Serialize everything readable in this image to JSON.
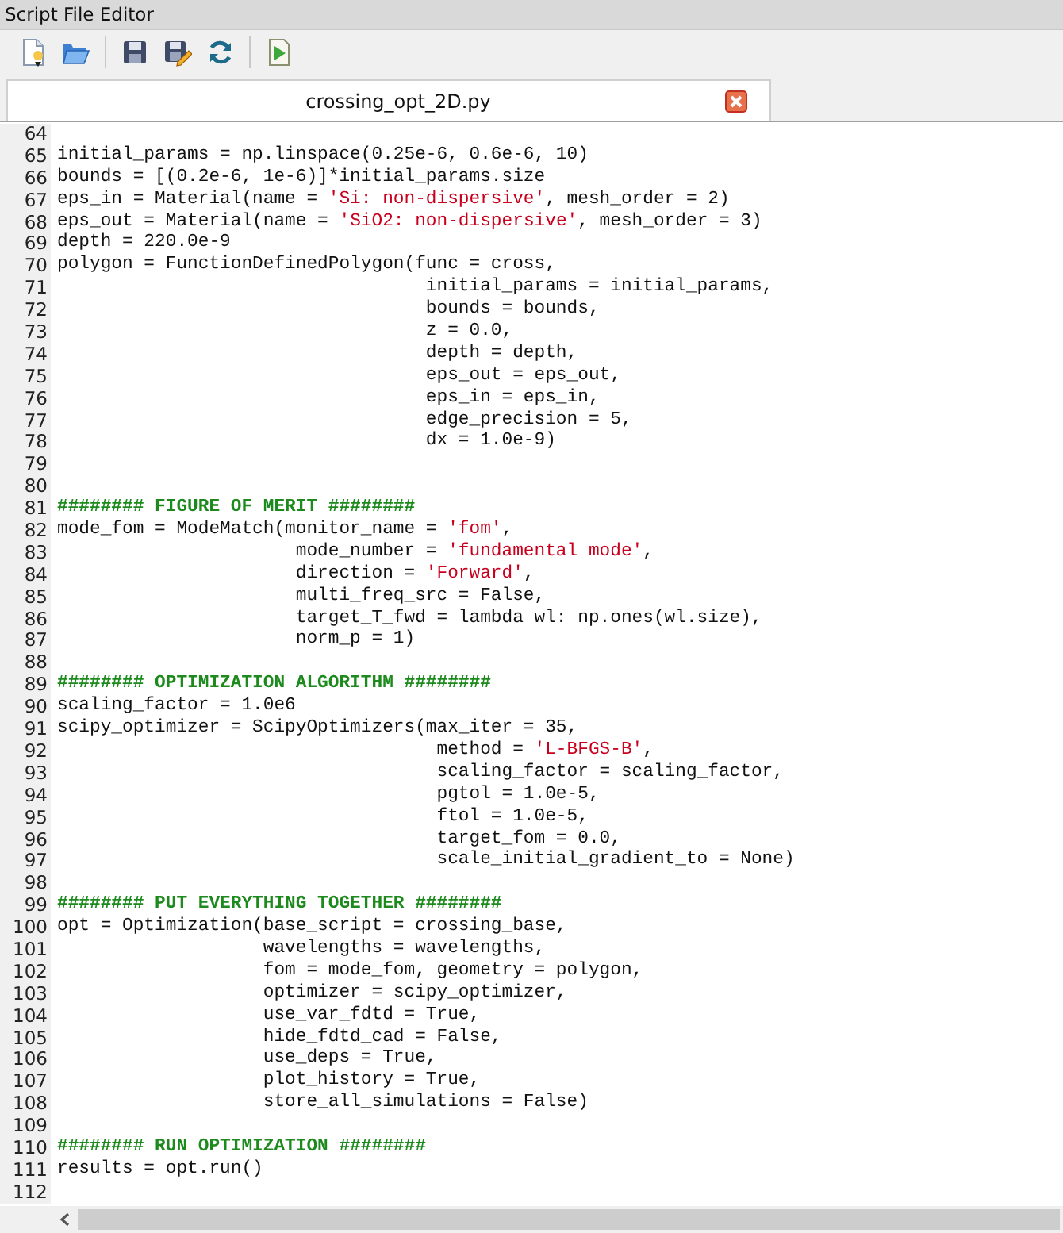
{
  "window": {
    "title": "Script File Editor"
  },
  "toolbar": [
    {
      "kind": "new"
    },
    {
      "kind": "open"
    },
    {
      "kind": "separator"
    },
    {
      "kind": "save"
    },
    {
      "kind": "save_as"
    },
    {
      "kind": "refresh"
    },
    {
      "kind": "separator"
    },
    {
      "kind": "run"
    }
  ],
  "tabs": [
    {
      "label": "crossing_opt_2D.py",
      "selected": true,
      "closable": true
    }
  ],
  "editor": {
    "lines": [
      {
        "number": "64"
      },
      {
        "number": "65",
        "segments": [
          {
            "kind": "code",
            "text": "initial_params = np.linspace(0.25e-6, 0.6e-6, 10)"
          }
        ]
      },
      {
        "number": "66",
        "segments": [
          {
            "kind": "code",
            "text": "bounds = [(0.2e-6, 1e-6)]*initial_params.size"
          }
        ]
      },
      {
        "number": "67",
        "segments": [
          {
            "kind": "code",
            "text": "eps_in = Material(name = "
          },
          {
            "kind": "string",
            "text": "'Si: non-dispersive'"
          },
          {
            "kind": "code",
            "text": ", mesh_order = 2)"
          }
        ]
      },
      {
        "number": "68",
        "segments": [
          {
            "kind": "code",
            "text": "eps_out = Material(name = "
          },
          {
            "kind": "string",
            "text": "'SiO2: non-dispersive'"
          },
          {
            "kind": "code",
            "text": ", mesh_order = 3)"
          }
        ]
      },
      {
        "number": "69",
        "segments": [
          {
            "kind": "code",
            "text": "depth = 220.0e-9"
          }
        ]
      },
      {
        "number": "70",
        "segments": [
          {
            "kind": "code",
            "text": "polygon = FunctionDefinedPolygon(func = cross,"
          }
        ]
      },
      {
        "number": "71",
        "segments": [
          {
            "kind": "code",
            "text": "                                  initial_params = initial_params,"
          }
        ]
      },
      {
        "number": "72",
        "segments": [
          {
            "kind": "code",
            "text": "                                  bounds = bounds,"
          }
        ]
      },
      {
        "number": "73",
        "segments": [
          {
            "kind": "code",
            "text": "                                  z = 0.0,"
          }
        ]
      },
      {
        "number": "74",
        "segments": [
          {
            "kind": "code",
            "text": "                                  depth = depth,"
          }
        ]
      },
      {
        "number": "75",
        "segments": [
          {
            "kind": "code",
            "text": "                                  eps_out = eps_out,"
          }
        ]
      },
      {
        "number": "76",
        "segments": [
          {
            "kind": "code",
            "text": "                                  eps_in = eps_in,"
          }
        ]
      },
      {
        "number": "77",
        "segments": [
          {
            "kind": "code",
            "text": "                                  edge_precision = 5,"
          }
        ]
      },
      {
        "number": "78",
        "segments": [
          {
            "kind": "code",
            "text": "                                  dx = 1.0e-9)"
          }
        ]
      },
      {
        "number": "79"
      },
      {
        "number": "80"
      },
      {
        "number": "81",
        "segments": [
          {
            "kind": "comment",
            "text": "######## FIGURE OF MERIT ########"
          }
        ]
      },
      {
        "number": "82",
        "segments": [
          {
            "kind": "code",
            "text": "mode_fom = ModeMatch(monitor_name = "
          },
          {
            "kind": "string",
            "text": "'fom'"
          },
          {
            "kind": "code",
            "text": ","
          }
        ]
      },
      {
        "number": "83",
        "segments": [
          {
            "kind": "code",
            "text": "                      mode_number = "
          },
          {
            "kind": "string",
            "text": "'fundamental mode'"
          },
          {
            "kind": "code",
            "text": ","
          }
        ]
      },
      {
        "number": "84",
        "segments": [
          {
            "kind": "code",
            "text": "                      direction = "
          },
          {
            "kind": "string",
            "text": "'Forward'"
          },
          {
            "kind": "code",
            "text": ","
          }
        ]
      },
      {
        "number": "85",
        "segments": [
          {
            "kind": "code",
            "text": "                      multi_freq_src = False,"
          }
        ]
      },
      {
        "number": "86",
        "segments": [
          {
            "kind": "code",
            "text": "                      target_T_fwd = lambda wl: np.ones(wl.size),"
          }
        ]
      },
      {
        "number": "87",
        "segments": [
          {
            "kind": "code",
            "text": "                      norm_p = 1)"
          }
        ]
      },
      {
        "number": "88"
      },
      {
        "number": "89",
        "segments": [
          {
            "kind": "comment",
            "text": "######## OPTIMIZATION ALGORITHM ########"
          }
        ]
      },
      {
        "number": "90",
        "segments": [
          {
            "kind": "code",
            "text": "scaling_factor = 1.0e6"
          }
        ]
      },
      {
        "number": "91",
        "segments": [
          {
            "kind": "code",
            "text": "scipy_optimizer = ScipyOptimizers(max_iter = 35,"
          }
        ]
      },
      {
        "number": "92",
        "segments": [
          {
            "kind": "code",
            "text": "                                   method = "
          },
          {
            "kind": "string",
            "text": "'L-BFGS-B'"
          },
          {
            "kind": "code",
            "text": ","
          }
        ]
      },
      {
        "number": "93",
        "segments": [
          {
            "kind": "code",
            "text": "                                   scaling_factor = scaling_factor,"
          }
        ]
      },
      {
        "number": "94",
        "segments": [
          {
            "kind": "code",
            "text": "                                   pgtol = 1.0e-5,"
          }
        ]
      },
      {
        "number": "95",
        "segments": [
          {
            "kind": "code",
            "text": "                                   ftol = 1.0e-5,"
          }
        ]
      },
      {
        "number": "96",
        "segments": [
          {
            "kind": "code",
            "text": "                                   target_fom = 0.0,"
          }
        ]
      },
      {
        "number": "97",
        "segments": [
          {
            "kind": "code",
            "text": "                                   scale_initial_gradient_to = None)"
          }
        ]
      },
      {
        "number": "98"
      },
      {
        "number": "99",
        "segments": [
          {
            "kind": "comment",
            "text": "######## PUT EVERYTHING TOGETHER ########"
          }
        ]
      },
      {
        "number": "100",
        "segments": [
          {
            "kind": "code",
            "text": "opt = Optimization(base_script = crossing_base,"
          }
        ]
      },
      {
        "number": "101",
        "segments": [
          {
            "kind": "code",
            "text": "                   wavelengths = wavelengths,"
          }
        ]
      },
      {
        "number": "102",
        "segments": [
          {
            "kind": "code",
            "text": "                   fom = mode_fom, geometry = polygon,"
          }
        ]
      },
      {
        "number": "103",
        "segments": [
          {
            "kind": "code",
            "text": "                   optimizer = scipy_optimizer,"
          }
        ]
      },
      {
        "number": "104",
        "segments": [
          {
            "kind": "code",
            "text": "                   use_var_fdtd = True,"
          }
        ]
      },
      {
        "number": "105",
        "segments": [
          {
            "kind": "code",
            "text": "                   hide_fdtd_cad = False,"
          }
        ]
      },
      {
        "number": "106",
        "segments": [
          {
            "kind": "code",
            "text": "                   use_deps = True,"
          }
        ]
      },
      {
        "number": "107",
        "segments": [
          {
            "kind": "code",
            "text": "                   plot_history = True,"
          }
        ]
      },
      {
        "number": "108",
        "segments": [
          {
            "kind": "code",
            "text": "                   store_all_simulations = False)"
          }
        ]
      },
      {
        "number": "109"
      },
      {
        "number": "110",
        "segments": [
          {
            "kind": "comment",
            "text": "######## RUN OPTIMIZATION ########"
          }
        ]
      },
      {
        "number": "111",
        "segments": [
          {
            "kind": "code",
            "text": "results = opt.run()"
          }
        ]
      },
      {
        "number": "112"
      }
    ]
  }
}
